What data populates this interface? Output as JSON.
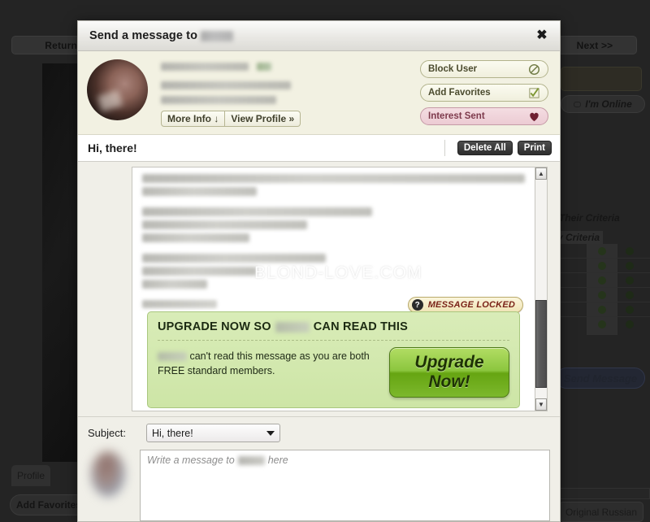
{
  "background": {
    "return_button": "Return To ",
    "next_button": "Next >>",
    "online_button": "I'm Online",
    "their_criteria": "Their Criteria",
    "my_criteria": "My Criteria",
    "send_message_button": "Send Message",
    "profile_tab": "Profile",
    "add_favorites_button": "Add Favorites",
    "original_russian_button": "Original Russian"
  },
  "modal": {
    "title_prefix": "Send a message to",
    "close_icon": "close-icon",
    "profile": {
      "more_info_button": "More Info ↓",
      "view_profile_button": "View Profile »",
      "actions": [
        {
          "label": "Block User",
          "icon": "block-icon"
        },
        {
          "label": "Add Favorites",
          "icon": "check-icon"
        },
        {
          "label": "Interest Sent",
          "icon": "heart-icon"
        }
      ]
    },
    "thread": {
      "subject": "Hi, there!",
      "delete_all_button": "Delete All",
      "print_button": "Print",
      "watermark": "BLOND-LOVE.COM",
      "locked_badge": "MESSAGE LOCKED",
      "locked_badge_icon": "question-mark-icon"
    },
    "upgrade": {
      "title_before": "UPGRADE NOW SO",
      "title_after": "CAN READ THIS",
      "body_text": "can't read this message as you are both FREE standard members.",
      "button_line1": "Upgrade",
      "button_line2": "Now!"
    },
    "compose": {
      "subject_label": "Subject:",
      "subject_value": "Hi, there!",
      "message_placeholder_before": "Write a message to",
      "message_placeholder_after": "here",
      "message_value": ""
    },
    "scrollbar": {
      "up_arrow": "▲",
      "down_arrow": "▼"
    }
  },
  "colors": {
    "modal_bg": "#f0efe8",
    "profile_bg": "#f2f1e2",
    "upgrade_green": "#cde5a6",
    "upgrade_button": "#8cc63f",
    "interest_pink": "#eccbd3",
    "locked_cream": "#efe4b4"
  }
}
